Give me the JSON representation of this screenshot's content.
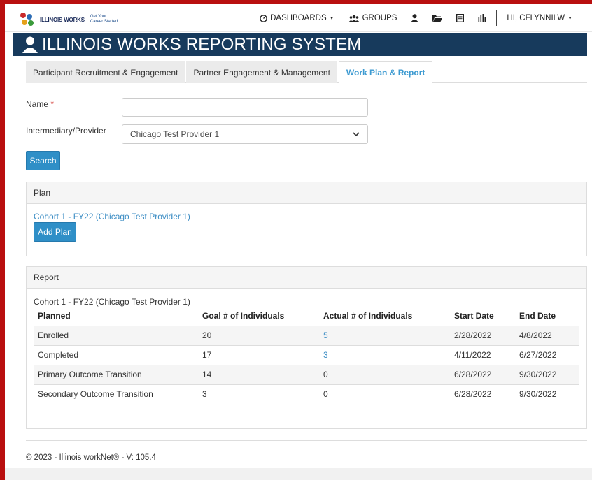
{
  "header": {
    "logo_text": "ILLINOIS WORKS",
    "logo_sub_text": "Get Your Career Started",
    "nav": {
      "dashboards": "DASHBOARDS",
      "groups": "GROUPS",
      "greeting": "HI, CFLYNNILW"
    }
  },
  "banner": {
    "title": "ILLINOIS WORKS REPORTING SYSTEM"
  },
  "tabs": [
    {
      "label": "Participant Recruitment & Engagement"
    },
    {
      "label": "Partner Engagement & Management"
    },
    {
      "label": "Work Plan & Report"
    }
  ],
  "form": {
    "name_label": "Name",
    "name_required_mark": "*",
    "name_value": "",
    "provider_label": "Intermediary/Provider",
    "provider_selected": "Chicago Test Provider 1",
    "search_button": "Search"
  },
  "plan_panel": {
    "heading": "Plan",
    "plan_link": "Cohort 1 - FY22 (Chicago Test Provider 1)",
    "add_button": "Add Plan"
  },
  "report_panel": {
    "heading": "Report",
    "subtitle": "Cohort 1 - FY22 (Chicago Test Provider 1)",
    "columns": [
      "Planned",
      "Goal # of Individuals",
      "Actual # of Individuals",
      "Start Date",
      "End Date"
    ],
    "rows": [
      {
        "planned": "Enrolled",
        "goal": "20",
        "actual": "5",
        "start": "2/28/2022",
        "end": "4/8/2022"
      },
      {
        "planned": "Completed",
        "goal": "17",
        "actual": "3",
        "start": "4/11/2022",
        "end": "6/27/2022"
      },
      {
        "planned": "Primary Outcome Transition",
        "goal": "14",
        "actual": "0",
        "start": "6/28/2022",
        "end": "9/30/2022"
      },
      {
        "planned": "Secondary Outcome Transition",
        "goal": "3",
        "actual": "0",
        "start": "6/28/2022",
        "end": "9/30/2022"
      }
    ]
  },
  "footer": {
    "text": "© 2023 - Illinois workNet® - V: 105.4"
  },
  "colors": {
    "accent": "#2f8fc7",
    "banner": "#173a5c",
    "border_red": "#b90f0f"
  }
}
